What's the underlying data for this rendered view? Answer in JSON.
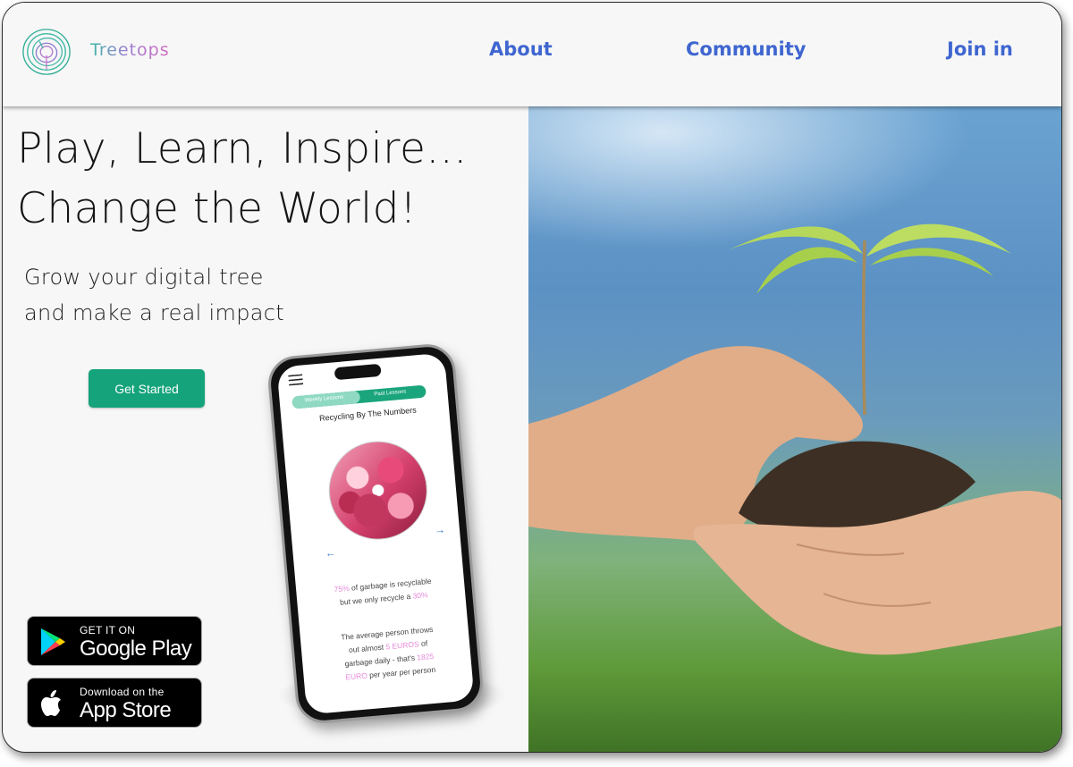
{
  "header": {
    "brand": "Treetops",
    "nav": [
      {
        "label": "About"
      },
      {
        "label": "Community"
      },
      {
        "label": "Join in"
      }
    ]
  },
  "hero": {
    "headline_line1": "Play, Learn, Inspire...",
    "headline_line2": "Change the World!",
    "subline_line1": "Grow your digital tree",
    "subline_line2": "and make a real impact",
    "cta_label": "Get Started"
  },
  "stores": {
    "google_play": {
      "small": "GET IT ON",
      "big": "Google Play",
      "icon": "google-play-icon"
    },
    "app_store": {
      "small": "Download on the",
      "big": "App Store",
      "icon": "apple-icon"
    }
  },
  "phone": {
    "tabs": [
      "Weekly Lessons",
      "Past Lessons"
    ],
    "active_tab": "Weekly Lessons",
    "lesson_title": "Recycling By The Numbers",
    "fact1": {
      "pct1": "75%",
      "text1": " of garbage is recyclable",
      "text2": "but we only recycle a ",
      "pct2": "30%"
    },
    "fact2": {
      "line1": "The average person throws",
      "text2": "out almost ",
      "amount": "5 EUROS",
      "text3": " of",
      "text4": "garbage daily - that's ",
      "yearly": "1825",
      "unit": "EURO",
      "text5": " per year per person"
    }
  },
  "colors": {
    "nav_link": "#3f66d0",
    "cta": "#14a37a",
    "highlight": "#e689d9",
    "segment": "#1aa57d"
  },
  "photo": {
    "subject": "hands-holding-seedling"
  }
}
